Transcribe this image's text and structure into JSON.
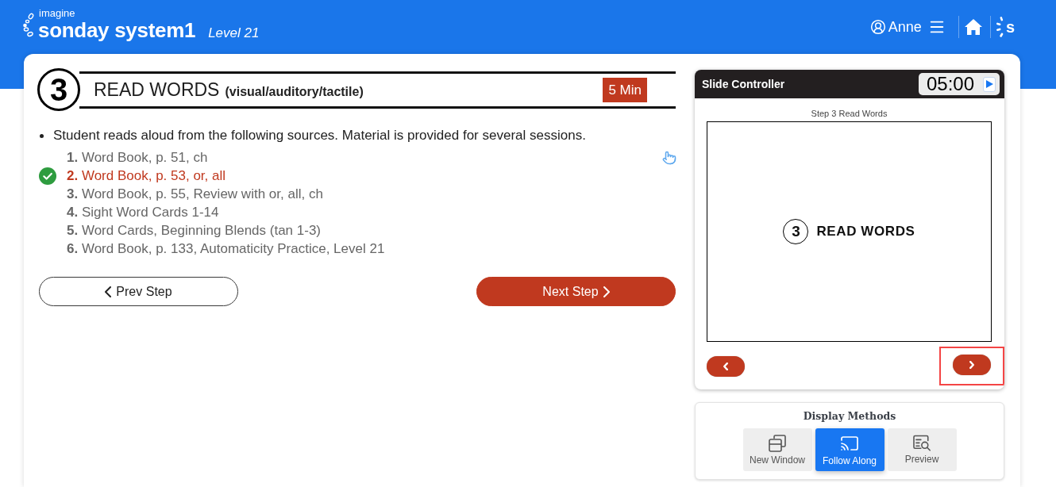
{
  "header": {
    "brand_tagline": "imagine",
    "brand_name": "sonday system1",
    "level": "Level 21",
    "user_name": "Anne",
    "logo_letter": "s"
  },
  "step": {
    "number": "3",
    "title": "READ WORDS",
    "modalities": "(visual/auditory/tactile)",
    "duration": "5 Min",
    "instruction": "Student reads aloud from the following sources. Material is provided for several sessions.",
    "sources": [
      {
        "text": "**1.** Word Book, p. 51, ch",
        "selected": false
      },
      {
        "text": "**2.** Word Book, p. 53, or, all",
        "selected": true
      },
      {
        "text": "**3.** Word Book, p. 55, Review with or, all, ch",
        "selected": false
      },
      {
        "text": "**4.** Sight Word Cards 1-14",
        "selected": false
      },
      {
        "text": "**5.** Word Cards, Beginning Blends (tan 1-3)",
        "selected": false
      },
      {
        "text": "**6.** Word Book, p. 133, Automaticity Practice, Level 21",
        "selected": false
      }
    ]
  },
  "step_nav": [
    {
      "kind": "prev",
      "label": "Prev Step"
    },
    {
      "kind": "next",
      "label": "Next Step"
    }
  ],
  "slide_controller": {
    "title": "Slide Controller",
    "timer": "05:00",
    "caption": "Step 3 Read Words",
    "slide": {
      "number": "3",
      "title": "READ WORDS"
    },
    "nav_buttons": [
      {
        "kind": "prev",
        "highlighted": false
      },
      {
        "kind": "next",
        "highlighted": true
      }
    ]
  },
  "display_methods": {
    "title": "Display Methods",
    "options": [
      {
        "kind": "new_window",
        "label": "New Window",
        "selected": false
      },
      {
        "kind": "follow_along",
        "label": "Follow Along",
        "selected": true
      },
      {
        "kind": "preview",
        "label": "Preview",
        "selected": false
      }
    ]
  }
}
